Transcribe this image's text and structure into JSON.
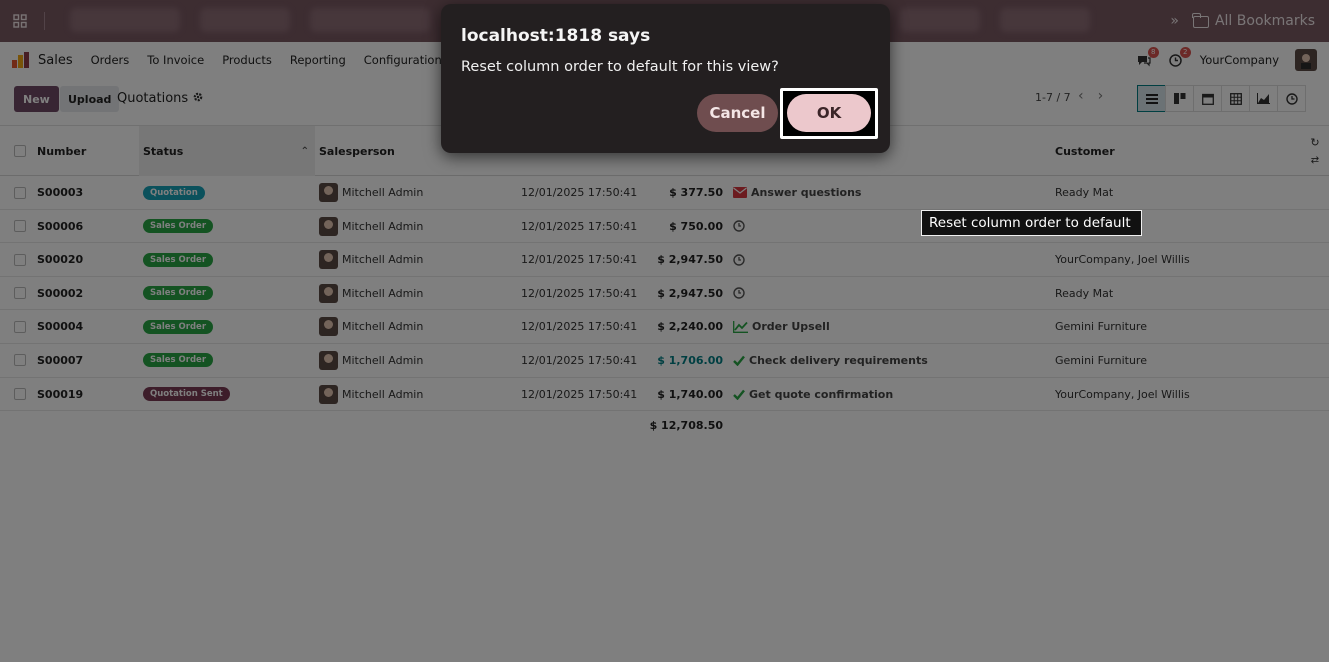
{
  "browser": {
    "bookmarks_label": "All Bookmarks",
    "overflow": "»"
  },
  "navbar": {
    "app_name": "Sales",
    "menu": [
      "Orders",
      "To Invoice",
      "Products",
      "Reporting",
      "Configuration"
    ],
    "messages_count": "8",
    "activities_count": "2",
    "company": "YourCompany"
  },
  "control": {
    "new_label": "New",
    "upload_label": "Upload",
    "title": "Quotations",
    "pager": "1-7 / 7"
  },
  "table": {
    "headers": {
      "number": "Number",
      "status": "Status",
      "salesperson": "Salesperson",
      "customer": "Customer"
    },
    "rows": [
      {
        "number": "S00003",
        "status": "Quotation",
        "status_color": "#17a2b8",
        "salesperson": "Mitchell Admin",
        "date": "12/01/2025 17:50:41",
        "amount": "$ 377.50",
        "amount_teal": false,
        "activity_icon": "envelope",
        "activity": "Answer questions",
        "customer": "Ready Mat"
      },
      {
        "number": "S00006",
        "status": "Sales Order",
        "status_color": "#28a745",
        "salesperson": "Mitchell Admin",
        "date": "12/01/2025 17:50:41",
        "amount": "$ 750.00",
        "amount_teal": false,
        "activity_icon": "clock",
        "activity": "",
        "customer": ""
      },
      {
        "number": "S00020",
        "status": "Sales Order",
        "status_color": "#28a745",
        "salesperson": "Mitchell Admin",
        "date": "12/01/2025 17:50:41",
        "amount": "$ 2,947.50",
        "amount_teal": false,
        "activity_icon": "clock",
        "activity": "",
        "customer": "YourCompany, Joel Willis"
      },
      {
        "number": "S00002",
        "status": "Sales Order",
        "status_color": "#28a745",
        "salesperson": "Mitchell Admin",
        "date": "12/01/2025 17:50:41",
        "amount": "$ 2,947.50",
        "amount_teal": false,
        "activity_icon": "clock",
        "activity": "",
        "customer": "Ready Mat"
      },
      {
        "number": "S00004",
        "status": "Sales Order",
        "status_color": "#28a745",
        "salesperson": "Mitchell Admin",
        "date": "12/01/2025 17:50:41",
        "amount": "$ 2,240.00",
        "amount_teal": false,
        "activity_icon": "chart",
        "activity": "Order Upsell",
        "customer": "Gemini Furniture"
      },
      {
        "number": "S00007",
        "status": "Sales Order",
        "status_color": "#28a745",
        "salesperson": "Mitchell Admin",
        "date": "12/01/2025 17:50:41",
        "amount": "$ 1,706.00",
        "amount_teal": true,
        "activity_icon": "check",
        "activity": "Check delivery requirements",
        "customer": "Gemini Furniture"
      },
      {
        "number": "S00019",
        "status": "Quotation Sent",
        "status_color": "#7b3b55",
        "salesperson": "Mitchell Admin",
        "date": "12/01/2025 17:50:41",
        "amount": "$ 1,740.00",
        "amount_teal": false,
        "activity_icon": "check",
        "activity": "Get quote confirmation",
        "customer": "YourCompany, Joel Willis"
      }
    ],
    "total": "$ 12,708.50"
  },
  "dialog": {
    "title": "localhost:1818 says",
    "message": "Reset column order to default for this view?",
    "cancel_label": "Cancel",
    "ok_label": "OK"
  },
  "tooltip": {
    "text": "Reset column order to default"
  },
  "colors": {
    "brand": "#714b67",
    "teal": "#017e84"
  }
}
